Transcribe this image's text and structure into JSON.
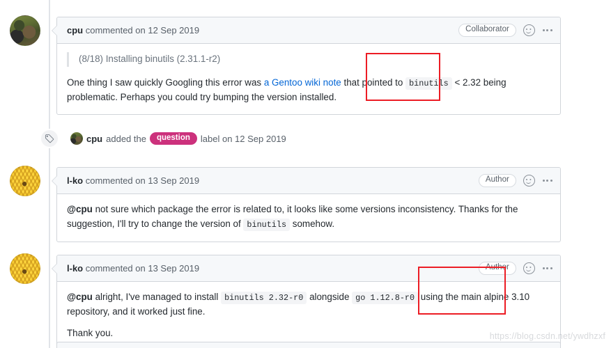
{
  "watermark": "https://blog.csdn.net/ywdhzxf",
  "comments": [
    {
      "author": "cpu",
      "meta": " commented on 12 Sep 2019",
      "role_badge": "Collaborator",
      "avatar": "cpu-avatar",
      "quote": "(8/18) Installing binutils (2.31.1-r2)",
      "body_before_link": "One thing I saw quickly Googling this error was ",
      "link_text": "a Gentoo wiki note",
      "body_after_link": " that pointed to ",
      "code_1": "binutils",
      "body_tail": " < 2.32 being problematic. Perhaps you could try bumping the version installed."
    },
    {
      "author": "l-ko",
      "meta": " commented on 13 Sep 2019",
      "role_badge": "Author",
      "avatar": "lko-avatar",
      "mention": "@cpu",
      "body_1": " not sure which package the error is related to, it looks like some versions inconsistency. Thanks for the suggestion, I'll try to change the version of ",
      "code_1": "binutils",
      "body_2": " somehow."
    },
    {
      "author": "l-ko",
      "meta": " commented on 13 Sep 2019",
      "role_badge": "Author",
      "avatar": "lko-avatar",
      "mention": "@cpu",
      "body_1": " alright, I've managed to install ",
      "code_1": "binutils 2.32-r0",
      "body_2": " alongside ",
      "code_2": "go 1.12.8-r0",
      "body_3": " using the main alpine 3.10 repository, and it worked just fine.",
      "body_4": "Thank you."
    }
  ],
  "label_event": {
    "icon": "tag-icon",
    "actor": "cpu",
    "verb": " added the ",
    "label": "question",
    "suffix": " label on 12 Sep 2019"
  },
  "annotations": {
    "color": "#ec1c24",
    "box1_note": "binutils < 2.32",
    "box2_note": "alpine 3.10 repository"
  },
  "icons": {
    "reaction": "smiley-icon",
    "menu": "kebab-menu-icon"
  }
}
